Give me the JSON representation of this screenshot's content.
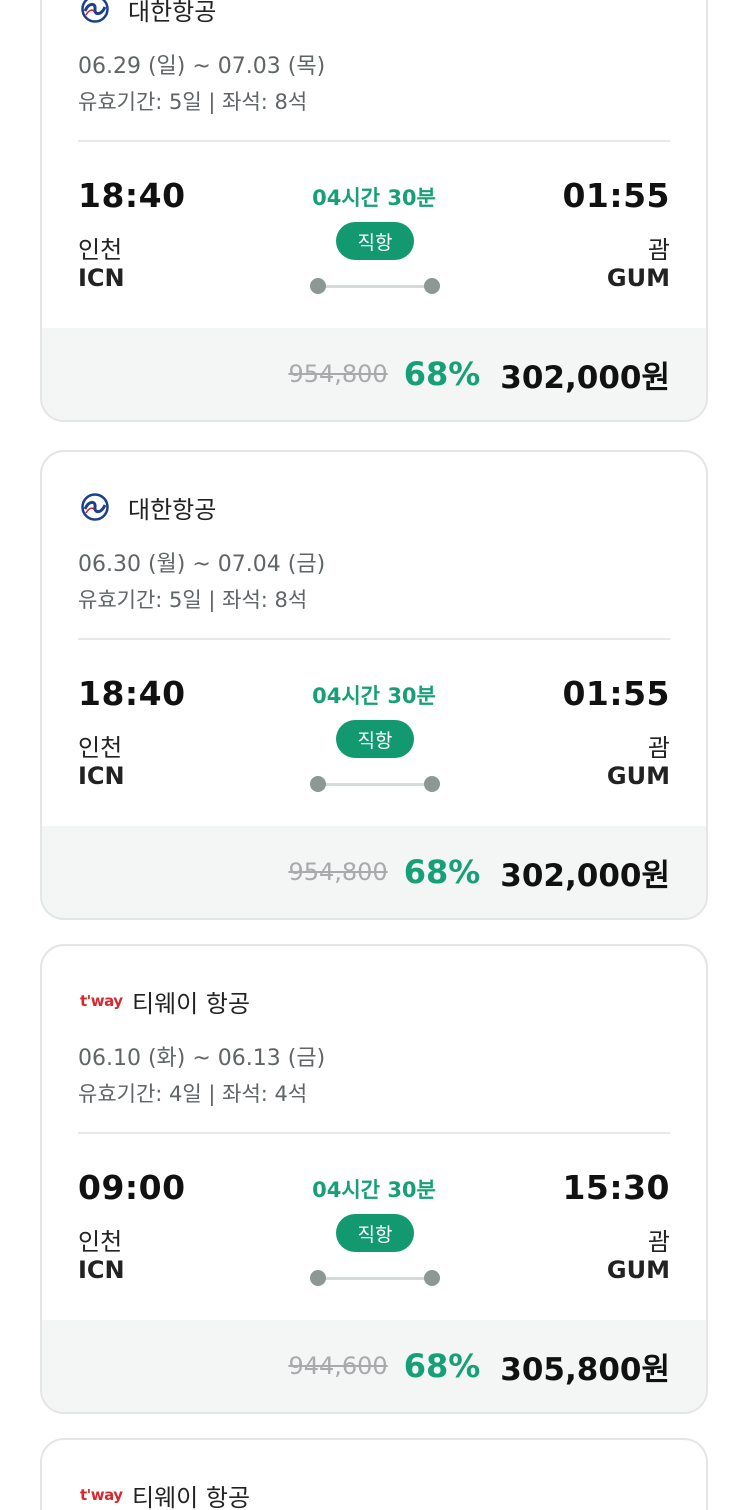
{
  "flights": [
    {
      "airline": "대한항공",
      "logo": "korean-air-logo",
      "dates": "06.29 (일) ~ 07.03 (목)",
      "validity": "유효기간: 5일 | 좌석: 8석",
      "dep_time": "18:40",
      "dep_city": "인천",
      "dep_code": "ICN",
      "duration": "04시간 30분",
      "type": "직항",
      "arr_time": "01:55",
      "arr_city": "괌",
      "arr_code": "GUM",
      "orig_price": "954,800",
      "discount": "68%",
      "price": "302,000원"
    },
    {
      "airline": "대한항공",
      "logo": "korean-air-logo",
      "dates": "06.30 (월) ~ 07.04 (금)",
      "validity": "유효기간: 5일 | 좌석: 8석",
      "dep_time": "18:40",
      "dep_city": "인천",
      "dep_code": "ICN",
      "duration": "04시간 30분",
      "type": "직항",
      "arr_time": "01:55",
      "arr_city": "괌",
      "arr_code": "GUM",
      "orig_price": "954,800",
      "discount": "68%",
      "price": "302,000원"
    },
    {
      "airline": "티웨이 항공",
      "logo": "tway-logo",
      "logo_text": "t'way",
      "dates": "06.10 (화) ~ 06.13 (금)",
      "validity": "유효기간: 4일 | 좌석: 4석",
      "dep_time": "09:00",
      "dep_city": "인천",
      "dep_code": "ICN",
      "duration": "04시간 30분",
      "type": "직항",
      "arr_time": "15:30",
      "arr_city": "괌",
      "arr_code": "GUM",
      "orig_price": "944,600",
      "discount": "68%",
      "price": "305,800원"
    },
    {
      "airline": "티웨이 항공",
      "logo": "tway-logo",
      "logo_text": "t'way"
    }
  ],
  "colors": {
    "accent_green": "#17a078",
    "badge_green": "#12996f",
    "tway_red": "#d8282f",
    "korean_air_blue": "#1b3f8f"
  }
}
